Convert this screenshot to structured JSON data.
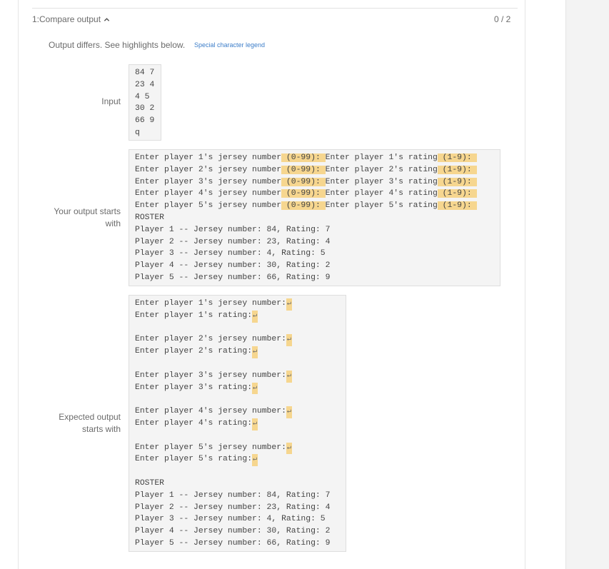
{
  "header": {
    "title": "1:Compare output",
    "score": "0 / 2",
    "message": "Output differs. See highlights below.",
    "legend_link": "Special character legend"
  },
  "labels": {
    "input": "Input",
    "your_output_1": "Your output starts",
    "your_output_2": "with",
    "expected_1": "Expected output",
    "expected_2": "starts with"
  },
  "input_lines": [
    "84 7",
    "23 4",
    "4 5",
    "30 2",
    "66 9",
    "q"
  ],
  "your_output": {
    "prompt_rows": [
      {
        "a": "Enter player 1's jersey number",
        "b": " (0-99)",
        "c": ": ",
        "d": "Enter player 1's rating",
        "e": " (1-9)",
        "f": ": "
      },
      {
        "a": "Enter player 2's jersey number",
        "b": " (0-99)",
        "c": ": ",
        "d": "Enter player 2's rating",
        "e": " (1-9)",
        "f": ": "
      },
      {
        "a": "Enter player 3's jersey number",
        "b": " (0-99)",
        "c": ": ",
        "d": "Enter player 3's rating",
        "e": " (1-9)",
        "f": ": "
      },
      {
        "a": "Enter player 4's jersey number",
        "b": " (0-99)",
        "c": ": ",
        "d": "Enter player 4's rating",
        "e": " (1-9)",
        "f": ": "
      },
      {
        "a": "Enter player 5's jersey number",
        "b": " (0-99)",
        "c": ": ",
        "d": "Enter player 5's rating",
        "e": " (1-9)",
        "f": ": "
      }
    ],
    "roster_lines": [
      "ROSTER",
      "Player 1 -- Jersey number: 84, Rating: 7",
      "Player 2 -- Jersey number: 23, Rating: 4",
      "Player 3 -- Jersey number: 4, Rating: 5",
      "Player 4 -- Jersey number: 30, Rating: 2",
      "Player 5 -- Jersey number: 66, Rating: 9"
    ]
  },
  "expected_output": {
    "newline_glyph": "↵",
    "prompt_blocks": [
      {
        "jersey": "Enter player 1's jersey number:",
        "rating": "Enter player 1's rating:"
      },
      {
        "jersey": "Enter player 2's jersey number:",
        "rating": "Enter player 2's rating:"
      },
      {
        "jersey": "Enter player 3's jersey number:",
        "rating": "Enter player 3's rating:"
      },
      {
        "jersey": "Enter player 4's jersey number:",
        "rating": "Enter player 4's rating:"
      },
      {
        "jersey": "Enter player 5's jersey number:",
        "rating": "Enter player 5's rating:"
      }
    ],
    "roster_lines": [
      "ROSTER",
      "Player 1 -- Jersey number: 84, Rating: 7",
      "Player 2 -- Jersey number: 23, Rating: 4",
      "Player 3 -- Jersey number: 4, Rating: 5",
      "Player 4 -- Jersey number: 30, Rating: 2",
      "Player 5 -- Jersey number: 66, Rating: 9"
    ]
  },
  "colors": {
    "highlight": "#f6d68f",
    "link": "#3d7ec9",
    "code_bg": "#f4f4f4"
  }
}
